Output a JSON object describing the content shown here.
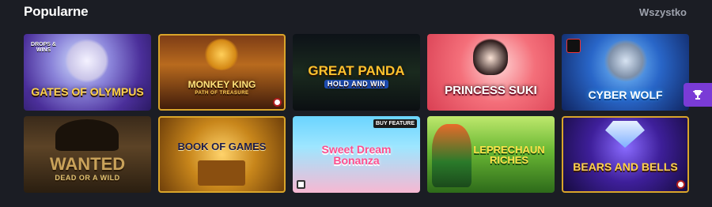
{
  "section": {
    "title": "Popularne",
    "see_all": "Wszystko"
  },
  "games": [
    {
      "name": "GATES of OLYMPUS",
      "badge": "DROPS & WINS"
    },
    {
      "name": "MONKEY KING",
      "sub": "PATH OF TREASURE"
    },
    {
      "name": "GREAT PANDA",
      "sub": "HOLD AND WIN"
    },
    {
      "name": "PRINCESS SUKI"
    },
    {
      "name": "CYBER WOLF"
    },
    {
      "name": "WANTED",
      "sub": "DEAD OR A WILD"
    },
    {
      "name": "BOOK of GAMES"
    },
    {
      "name": "Sweet Dream Bonanza",
      "badge": "BUY FEATURE"
    },
    {
      "name": "LEPRECHAUN RICHES"
    },
    {
      "name": "BEARS and BELLS"
    }
  ],
  "icons": {
    "trophy": "trophy-icon"
  }
}
